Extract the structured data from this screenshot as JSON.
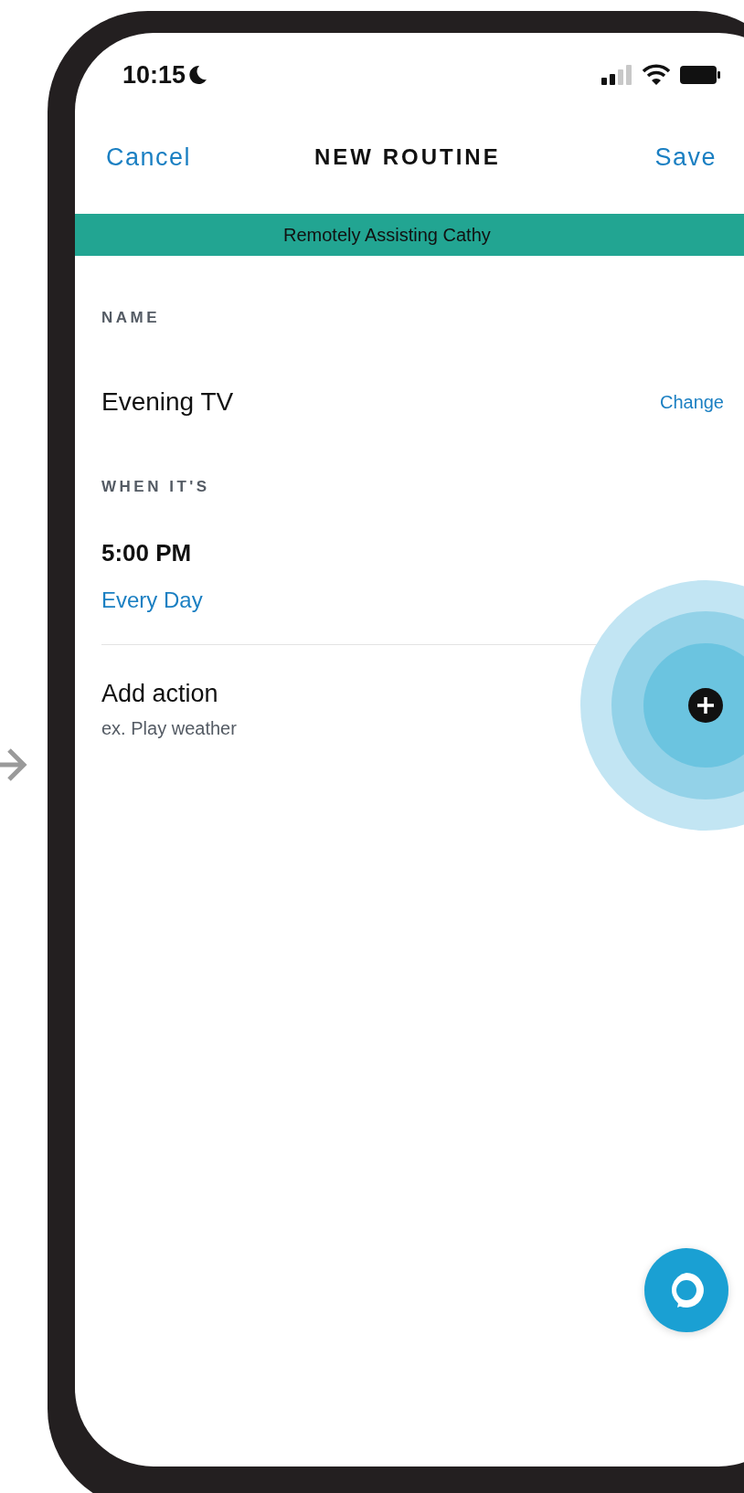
{
  "status_bar": {
    "time": "10:15"
  },
  "nav": {
    "cancel": "Cancel",
    "title": "NEW ROUTINE",
    "save": "Save"
  },
  "banner": "Remotely Assisting Cathy",
  "name_section": {
    "label": "NAME",
    "value": "Evening TV",
    "action": "Change"
  },
  "when_section": {
    "label": "WHEN IT'S",
    "time": "5:00 PM",
    "recurrence": "Every Day"
  },
  "add_action": {
    "title": "Add action",
    "hint": "ex. Play weather"
  }
}
